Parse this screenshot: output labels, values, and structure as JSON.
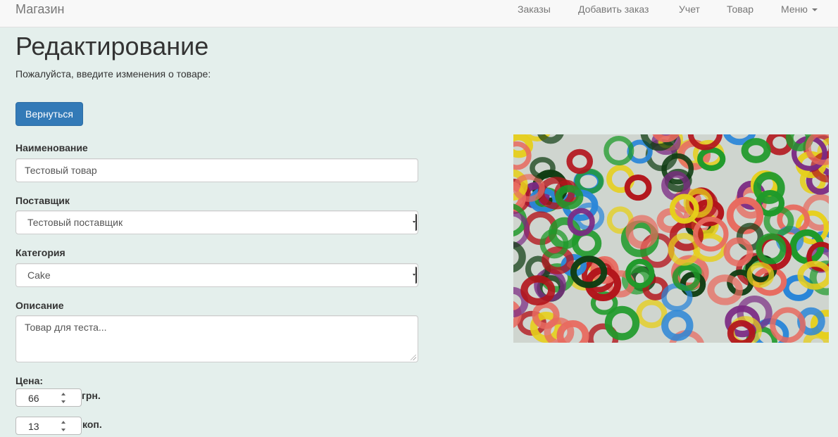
{
  "navbar": {
    "brand": "Магазин",
    "items": [
      {
        "label": "Заказы"
      },
      {
        "label": "Добавить заказ"
      },
      {
        "label": "Учет"
      },
      {
        "label": "Товар"
      },
      {
        "label": "Меню"
      }
    ]
  },
  "page": {
    "title": "Редактирование",
    "subtitle": "Пожалуйста, введите изменения о товаре:",
    "back_button": "Вернуться"
  },
  "form": {
    "name": {
      "label": "Наименование",
      "value": "Тестовый товар"
    },
    "supplier": {
      "label": "Поставщик",
      "value": "Тестовый поставщик"
    },
    "category": {
      "label": "Категория",
      "value": "Cake"
    },
    "description": {
      "label": "Описание",
      "value": "Товар для теста..."
    },
    "price": {
      "label": "Цена:",
      "hryvnia": {
        "value": "66",
        "unit": "грн."
      },
      "kopeks": {
        "value": "13",
        "unit": "коп."
      }
    }
  },
  "image": {
    "icon": "product-photo",
    "colors": [
      "#b3141b",
      "#1f9a2a",
      "#2a86d8",
      "#e6cf1b",
      "#7b2a83",
      "#e86a5f",
      "#0f3d12"
    ]
  }
}
